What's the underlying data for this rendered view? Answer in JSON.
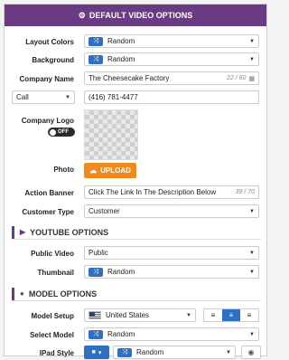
{
  "header": {
    "title": "DEFAULT VIDEO OPTIONS",
    "icon": "gears-icon"
  },
  "fields": {
    "layout_colors": {
      "label": "Layout Colors",
      "value": "Random"
    },
    "background": {
      "label": "Background",
      "value": "Random"
    },
    "company_name": {
      "label": "Company Name",
      "value": "The Cheesecake Factory",
      "count": "22 / 60"
    },
    "phone": {
      "type_value": "Call",
      "value": "(416) 781-4477"
    },
    "company_logo": {
      "label": "Company Logo",
      "toggle": "OFF"
    },
    "photo": {
      "label": "Photo",
      "button": "UPLOAD"
    },
    "action_banner": {
      "label": "Action Banner",
      "value": "Click The Link In The Description Below",
      "count": "39 / 70"
    },
    "customer_type": {
      "label": "Customer Type",
      "value": "Customer"
    }
  },
  "youtube": {
    "title": "YOUTUBE OPTIONS",
    "public_video": {
      "label": "Public Video",
      "value": "Public"
    },
    "thumbnail": {
      "label": "Thumbnail",
      "value": "Random"
    }
  },
  "model": {
    "title": "MODEL OPTIONS",
    "model_setup": {
      "label": "Model Setup",
      "value": "United States"
    },
    "select_model": {
      "label": "Select Model",
      "value": "Random"
    },
    "ipad_style": {
      "label": "IPad Style",
      "value": "Random"
    }
  },
  "colors": {
    "header": "#6a3a83",
    "accent_blue": "#2f6fc4",
    "upload_orange": "#f08a1c"
  }
}
